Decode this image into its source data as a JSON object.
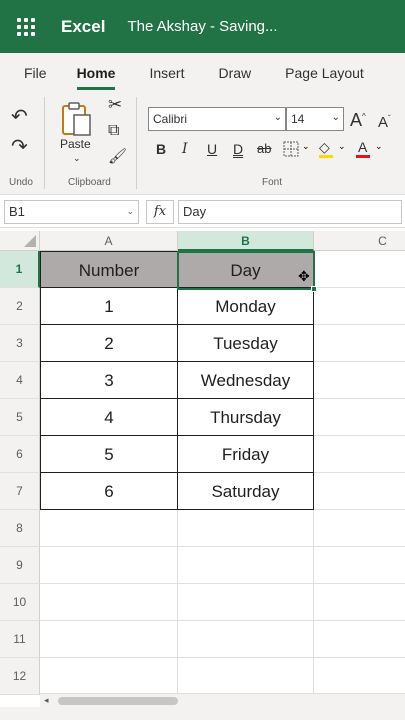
{
  "titlebar": {
    "app_name": "Excel",
    "doc_title": "The Akshay  -  Saving...",
    "color": "#217346"
  },
  "ribbon_tabs": [
    {
      "label": "File",
      "active": false
    },
    {
      "label": "Home",
      "active": true
    },
    {
      "label": "Insert",
      "active": false
    },
    {
      "label": "Draw",
      "active": false
    },
    {
      "label": "Page Layout",
      "active": false
    }
  ],
  "ribbon": {
    "undo_group_label": "Undo",
    "clipboard_group_label": "Clipboard",
    "font_group_label": "Font",
    "paste_label": "Paste",
    "font_name": "Calibri",
    "font_size": "14",
    "bold": "B",
    "italic": "I",
    "underline": "U",
    "double_underline": "D",
    "strikethrough": "ab",
    "grow_font": "A",
    "shrink_font": "A",
    "font_color_letter": "A",
    "font_color": "#e81123",
    "fill_color": "#ffd800"
  },
  "formula_bar": {
    "name_box": "B1",
    "fx_label": "fx",
    "value": "Day"
  },
  "grid": {
    "columns": [
      "A",
      "B",
      "C"
    ],
    "selected_column": "B",
    "rows": [
      "1",
      "2",
      "3",
      "4",
      "5",
      "6",
      "7",
      "8",
      "9",
      "10",
      "11",
      "12"
    ],
    "selected_row": "1",
    "header_fill": "#aeaaaa",
    "table": [
      [
        "Number",
        "Day"
      ],
      [
        "1",
        "Monday"
      ],
      [
        "2",
        "Tuesday"
      ],
      [
        "3",
        "Wednesday"
      ],
      [
        "4",
        "Thursday"
      ],
      [
        "5",
        "Friday"
      ],
      [
        "6",
        "Saturday"
      ]
    ]
  }
}
